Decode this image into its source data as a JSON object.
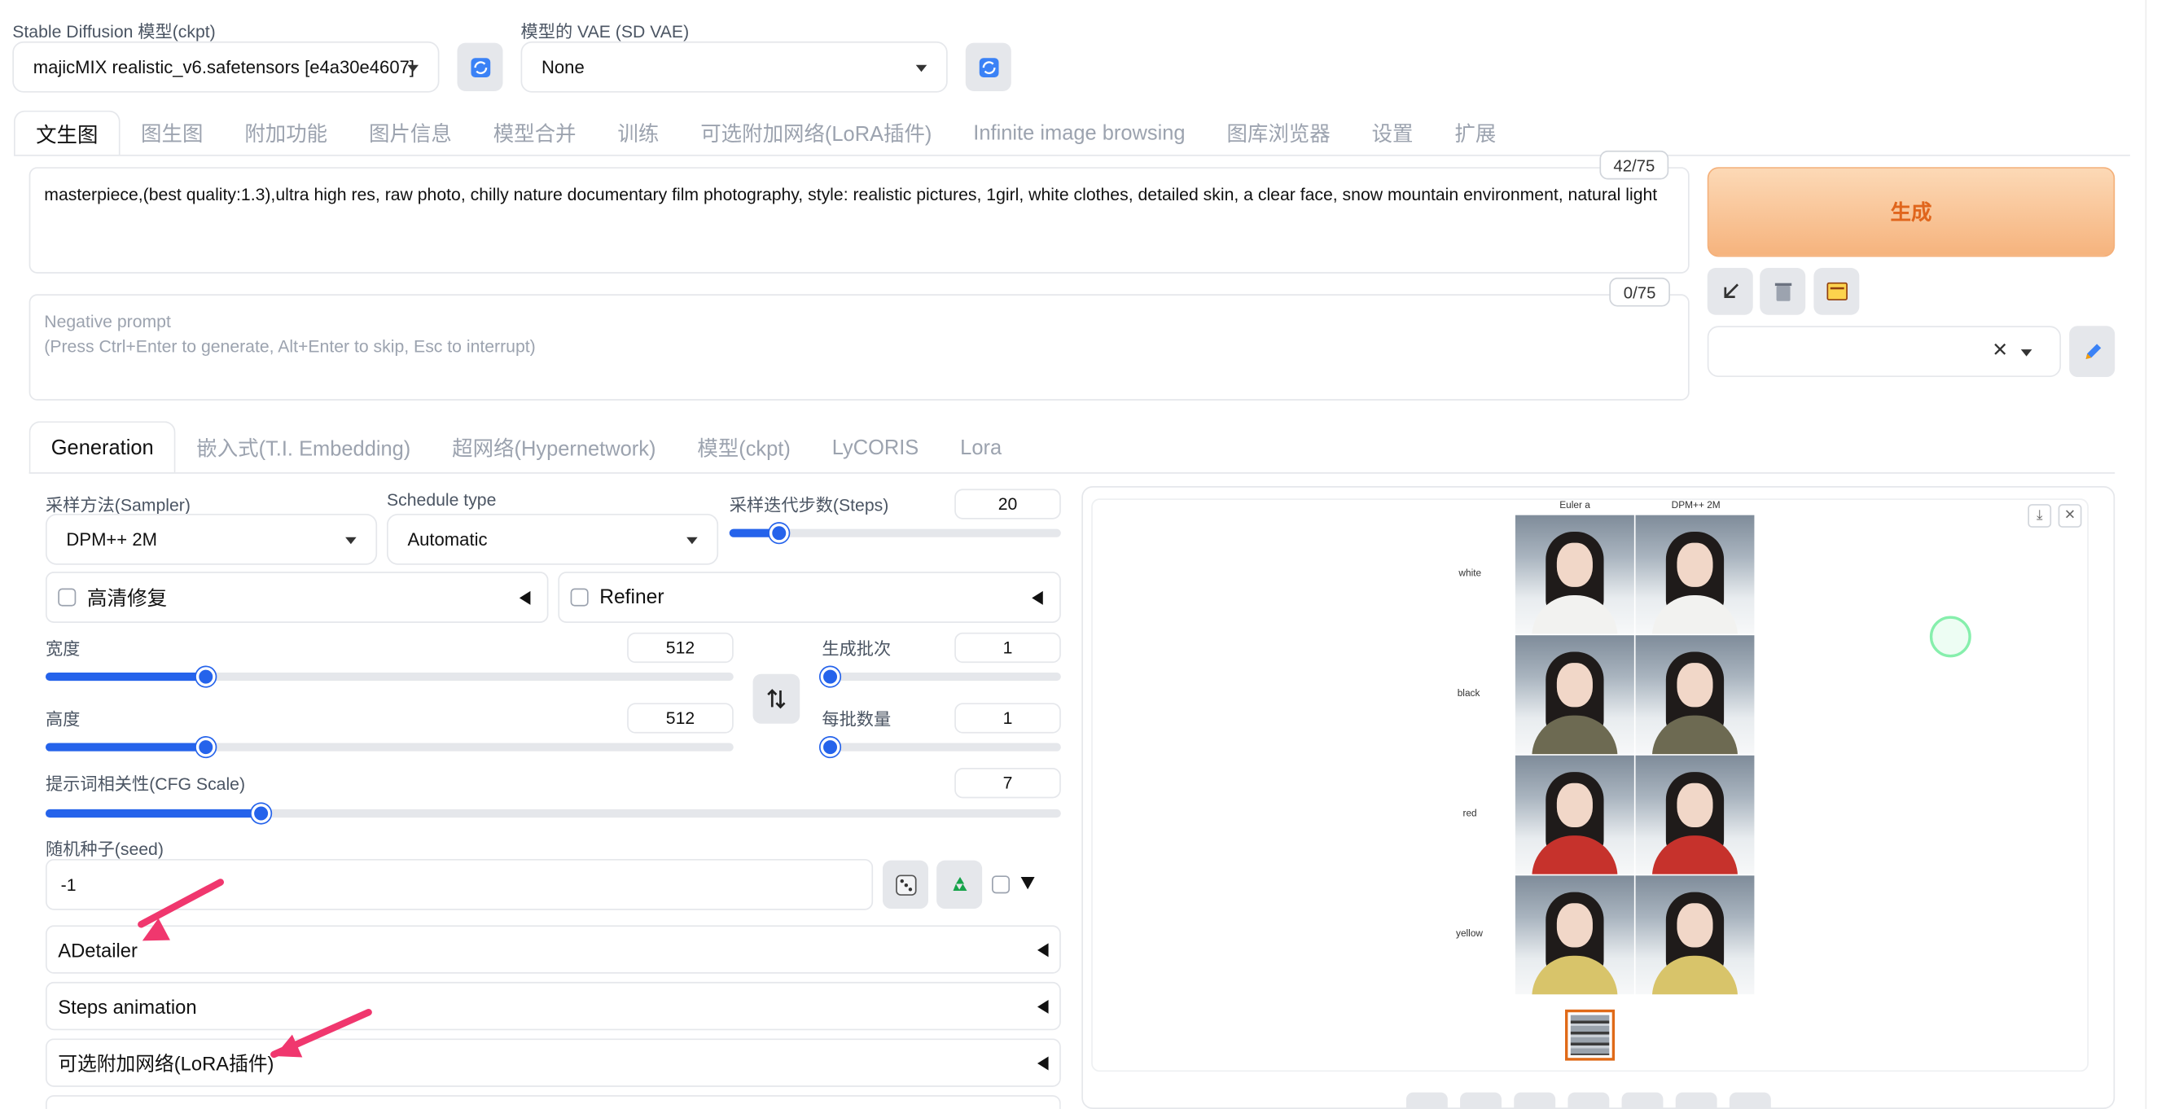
{
  "top": {
    "model_label": "Stable Diffusion 模型(ckpt)",
    "model_value": "majicMIX realistic_v6.safetensors [e4a30e4607]",
    "vae_label": "模型的 VAE (SD VAE)",
    "vae_value": "None"
  },
  "main_tabs": [
    "文生图",
    "图生图",
    "附加功能",
    "图片信息",
    "模型合并",
    "训练",
    "可选附加网络(LoRA插件)",
    "Infinite image browsing",
    "图库浏览器",
    "设置",
    "扩展"
  ],
  "prompt": {
    "text": "masterpiece,(best quality:1.3),ultra high res, raw photo, chilly nature documentary film photography, style: realistic pictures, 1girl, white clothes, detailed skin, a clear face, snow mountain environment, natural light",
    "counter": "42/75"
  },
  "negative": {
    "placeholder_line1": "Negative prompt",
    "placeholder_line2": "(Press Ctrl+Enter to generate, Alt+Enter to skip, Esc to interrupt)",
    "counter": "0/75"
  },
  "generate_label": "生成",
  "sub_tabs": [
    "Generation",
    "嵌入式(T.I. Embedding)",
    "超网络(Hypernetwork)",
    "模型(ckpt)",
    "LyCORIS",
    "Lora"
  ],
  "params": {
    "sampler_label": "采样方法(Sampler)",
    "sampler_value": "DPM++ 2M",
    "schedule_label": "Schedule type",
    "schedule_value": "Automatic",
    "steps_label": "采样迭代步数(Steps)",
    "steps_value": "20",
    "hires_label": "高清修复",
    "refiner_label": "Refiner",
    "width_label": "宽度",
    "width_value": "512",
    "height_label": "高度",
    "height_value": "512",
    "batch_count_label": "生成批次",
    "batch_count_value": "1",
    "batch_size_label": "每批数量",
    "batch_size_value": "1",
    "cfg_label": "提示词相关性(CFG Scale)",
    "cfg_value": "7",
    "seed_label": "随机种子(seed)",
    "seed_value": "-1"
  },
  "accordions": {
    "adetailer": "ADetailer",
    "steps_animation": "Steps animation",
    "lora": "可选附加网络(LoRA插件)"
  },
  "grid": {
    "columns": [
      "Euler a",
      "DPM++ 2M"
    ],
    "rows": [
      "white",
      "black",
      "red",
      "yellow"
    ],
    "row_colors": [
      "#f2f2f0",
      "#6d6a52",
      "#c6322c",
      "#d8c46a"
    ]
  }
}
